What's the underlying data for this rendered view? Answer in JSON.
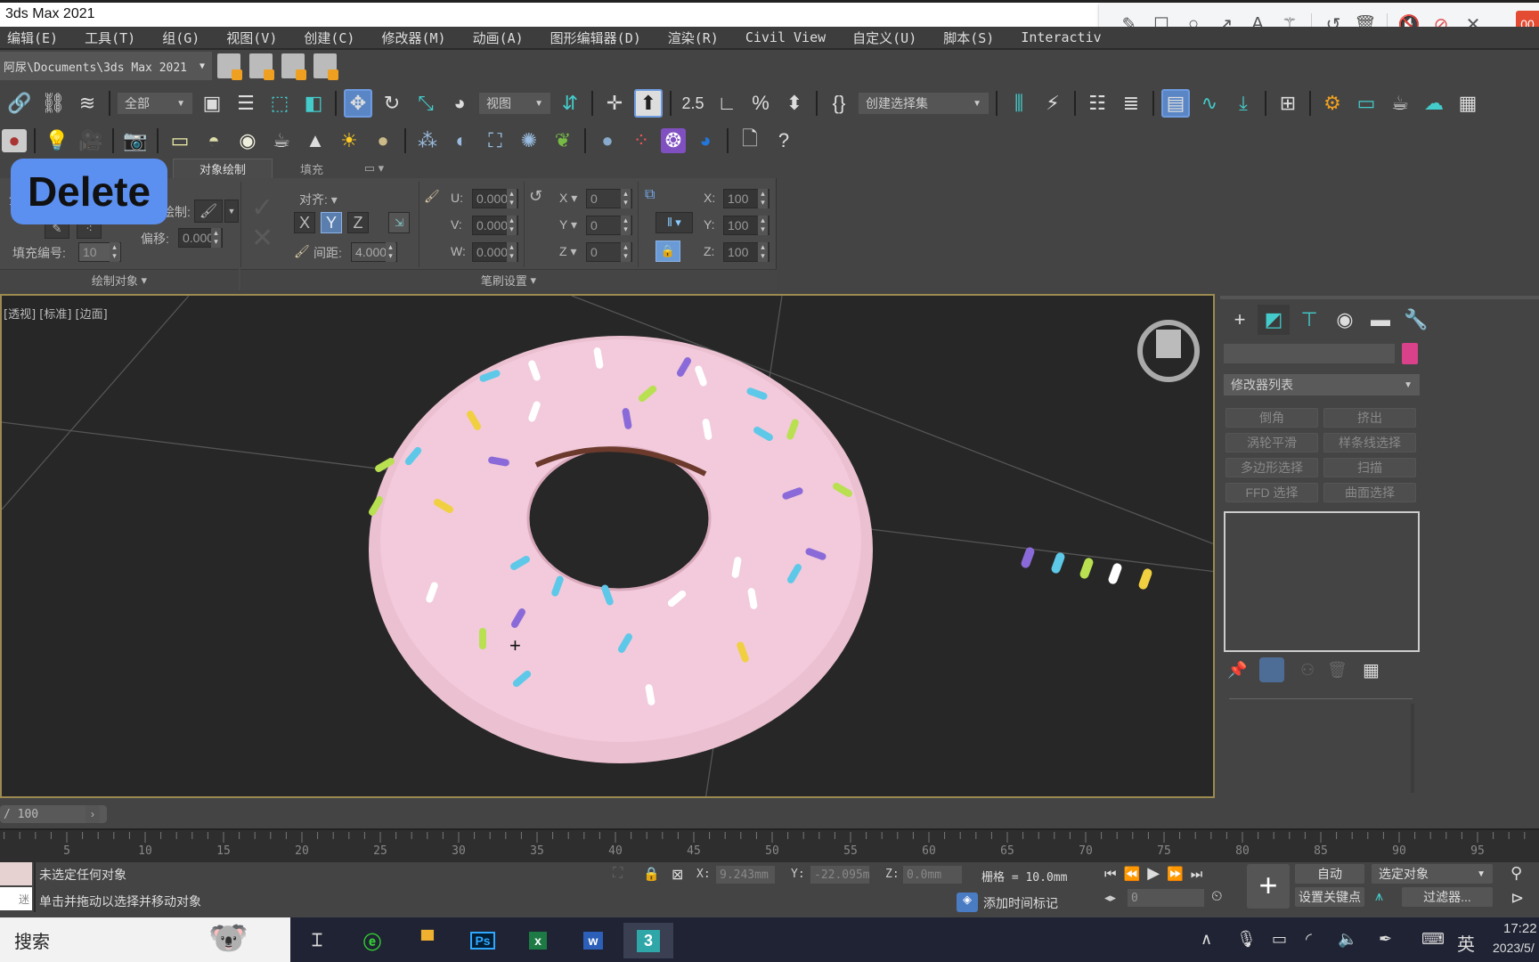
{
  "window": {
    "title": "3ds Max 2021"
  },
  "menu": [
    "编辑(E)",
    "工具(T)",
    "组(G)",
    "视图(V)",
    "创建(C)",
    "修改器(M)",
    "动画(A)",
    "图形编辑器(D)",
    "渲染(R)",
    "Civil View",
    "自定义(U)",
    "脚本(S)",
    "Interactiv"
  ],
  "recorder_toolbar": {
    "tools": [
      "pencil-icon",
      "rectangle-icon",
      "circle-icon",
      "arrow-icon",
      "text-icon",
      "magic-wand-icon",
      "undo-icon",
      "trash-icon",
      "speaker-muted-icon",
      "mic-muted-icon",
      "close-icon"
    ],
    "badge": "00"
  },
  "project_path": {
    "value": "阿尿\\Documents\\3ds Max 2021"
  },
  "main_toolbar": {
    "selection_filter": "全部",
    "ref_coord": "视图",
    "selection_set_placeholder": "创建选择集",
    "snap_label": "2.5"
  },
  "ribbon": {
    "tabs": [
      "对象绘制",
      "填充"
    ],
    "active_tab": "对象绘制",
    "overlay_key": "Delete",
    "paint_label": "绘制:",
    "offset_label": "偏移:",
    "offset_value": "0.000",
    "fill_number_label": "填充编号:",
    "fill_number_value": "10",
    "align_label": "对齐:",
    "axes": [
      "X",
      "Y",
      "Z"
    ],
    "active_axis": "Y",
    "spacing_label": "间距:",
    "spacing_value": "4.000",
    "uvw": [
      {
        "label": "U:",
        "value": "0.000"
      },
      {
        "label": "V:",
        "value": "0.000"
      },
      {
        "label": "W:",
        "value": "0.000"
      }
    ],
    "rotate": [
      {
        "label": "X",
        "value": "0"
      },
      {
        "label": "Y",
        "value": "0"
      },
      {
        "label": "Z",
        "value": "0"
      }
    ],
    "scale": [
      {
        "label": "X:",
        "value": "100"
      },
      {
        "label": "Y:",
        "value": "100"
      },
      {
        "label": "Z:",
        "value": "100"
      }
    ],
    "group_paint_objects": "绘制对象",
    "group_brush_settings": "笔刷设置"
  },
  "viewport": {
    "label": "[透视] [标准] [边面]",
    "object": "pink donut with sprinkles",
    "accent_colors": {
      "frosting": "#f2c8d8",
      "border": "#9c8a50"
    }
  },
  "command_panel": {
    "tabs": [
      "create-icon",
      "modify-icon",
      "hierarchy-icon",
      "motion-icon",
      "display-icon",
      "utilities-icon"
    ],
    "object_name": "",
    "object_color": "#d9418a",
    "modifier_list": "修改器列表",
    "modifier_buttons": [
      "倒角",
      "挤出",
      "涡轮平滑",
      "样条线选择",
      "多边形选择",
      "扫描",
      "FFD 选择",
      "曲面选择"
    ]
  },
  "timeline": {
    "frame_display": "/ 100",
    "ticks": [
      "5",
      "10",
      "15",
      "20",
      "25",
      "30",
      "35",
      "40",
      "45",
      "50",
      "55",
      "60",
      "65",
      "70",
      "75",
      "80",
      "85",
      "90",
      "95"
    ]
  },
  "status": {
    "selection": "未选定任何对象",
    "prompt": "单击并拖动以选择并移动对象",
    "mini_listener": "迷",
    "x_label": "X:",
    "x": "9.243mm",
    "y_label": "Y:",
    "y": "-22.095mm",
    "z_label": "Z:",
    "z": "0.0mm",
    "grid": "栅格 = 10.0mm",
    "add_time_tag": "添加时间标记",
    "auto_key": "自动",
    "set_key": "设置关键点",
    "key_filter_select": "选定对象",
    "filters": "过滤器...",
    "current_frame": "0"
  },
  "taskbar": {
    "search": "搜索",
    "apps": [
      "task-view-icon",
      "ie-icon",
      "file-explorer-icon",
      "photoshop-icon",
      "excel-icon",
      "word-icon",
      "3dsmax-icon"
    ],
    "ime": "英",
    "time": "17:22",
    "date": "2023/5/"
  }
}
